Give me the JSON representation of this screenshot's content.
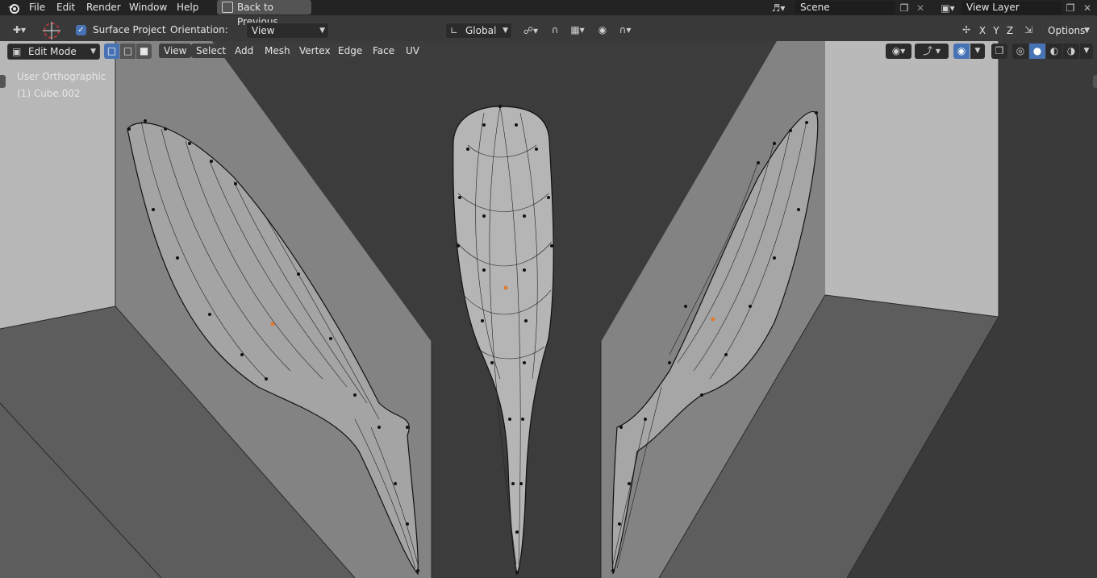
{
  "topbar": {
    "menu": [
      "File",
      "Edit",
      "Render",
      "Window",
      "Help"
    ],
    "back_button": "Back to Previous",
    "scene": "Scene",
    "view_layer": "View Layer"
  },
  "toolbar": {
    "surface_project_label": "Surface Project",
    "surface_project_checked": true,
    "orientation_label": "Orientation:",
    "orientation_value": "View",
    "transform_space": "Global",
    "axes": [
      "X",
      "Y",
      "Z"
    ],
    "options_label": "Options"
  },
  "header": {
    "mode": "Edit Mode",
    "menu": [
      "View",
      "Select",
      "Add",
      "Mesh",
      "Vertex",
      "Edge",
      "Face",
      "UV"
    ]
  },
  "viewport": {
    "view_name": "User Orthographic",
    "object_name": "(1) Cube.002"
  },
  "colors": {
    "topbar_bg": "#232323",
    "header_bg": "#393939",
    "accent_blue": "#4772b3",
    "mesh_light": "#bdbdbd",
    "origin_orange": "#e07a30"
  },
  "icons": {
    "blender_logo": "blender-logo-icon",
    "cursor": "3d-cursor-icon",
    "back": "screen-back-icon",
    "scene": "scene-icon",
    "view_layer": "view-layer-icon",
    "snap": "magnet-icon",
    "proportional": "proportional-edit-icon"
  }
}
